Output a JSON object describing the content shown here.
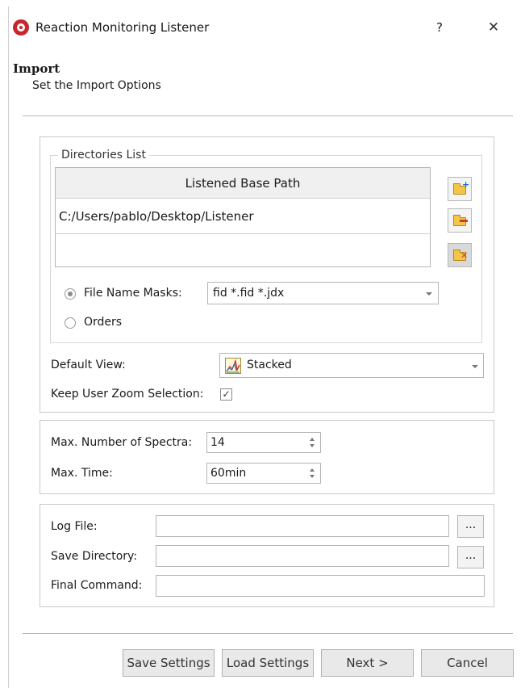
{
  "window": {
    "title": "Reaction Monitoring Listener",
    "help_label": "?",
    "close_label": "✕"
  },
  "header": {
    "title": "Import",
    "subtitle": "Set the Import Options"
  },
  "directories": {
    "legend": "Directories List",
    "column_header": "Listened Base Path",
    "rows": [
      "C:/Users/pablo/Desktop/Listener"
    ],
    "tools": [
      "add-folder-icon",
      "remove-folder-icon",
      "clear-folders-icon"
    ]
  },
  "mask": {
    "radio_label": "File Name Masks:",
    "value": "fid *.fid *.jdx",
    "selected": true
  },
  "orders": {
    "radio_label": "Orders",
    "selected": false
  },
  "view": {
    "label": "Default View:",
    "value": "Stacked",
    "icon": "stacked-spectra-icon"
  },
  "zoom": {
    "label": "Keep User Zoom Selection:",
    "check": "✓",
    "checked": true
  },
  "limits": {
    "spectra_label": "Max. Number of Spectra:",
    "spectra_value": "14",
    "time_label": "Max. Time:",
    "time_value": "60min"
  },
  "files": {
    "log_label": "Log File:",
    "save_dir_label": "Save Directory:",
    "command_label": "Final Command:",
    "browse_label": "..."
  },
  "footer": {
    "save": "Save Settings",
    "load": "Load Settings",
    "next": "Next >",
    "cancel": "Cancel"
  },
  "colors": {
    "app_icon": "#c8262f",
    "folder": "#f3c64a",
    "add_badge": "#1e6bd6",
    "remove_badge": "#d23b2a"
  }
}
